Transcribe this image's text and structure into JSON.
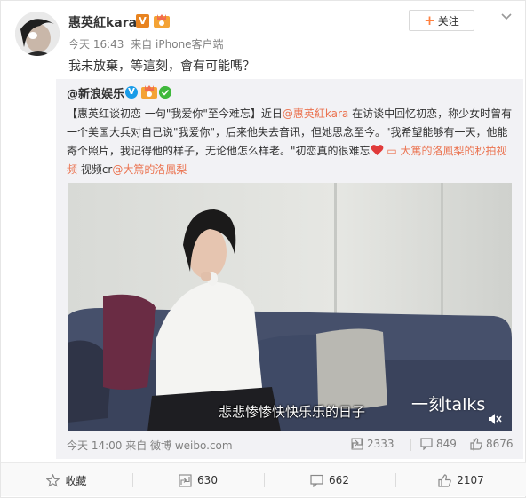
{
  "post": {
    "username": "惠英紅kara",
    "v_badge": "V",
    "time": "今天 16:43",
    "source": "来自 iPhone客户端",
    "text": "我未放棄，等這刻，會有可能嗎？",
    "follow_label": "关注",
    "follow_plus": "+"
  },
  "repost": {
    "username": "@新浪娱乐",
    "text_parts": {
      "line1_a": "【惠英红谈初恋 一句\"我爱你\"至今难忘】近日",
      "mention": "@惠英紅kara",
      "line1_b": " 在访谈中回忆初恋，称少女时曾有一个美国大兵对自己说\"我爱你\"，后来他失去音讯，但她思念至今。\"我希望能够有一天，他能寄个照片，我记得他的样子，无论他怎么样老。\"初恋真的很难忘",
      "video_link": "▭ 大篤的洛鳳梨的秒拍视频",
      "credit_prefix": " 视频cr",
      "credit_mention": "@大篤的洛鳳梨"
    },
    "video": {
      "subtitle": "悲悲惨惨快快乐乐的日子",
      "watermark": "一刻talks"
    },
    "time": "今天 14:00",
    "source": "来自 微博 weibo.com",
    "stats": {
      "reposts": "2333",
      "comments": "849",
      "likes": "8676"
    }
  },
  "actions": {
    "favorite": "收藏",
    "repost": "630",
    "comment": "662",
    "like": "2107"
  },
  "colors": {
    "accent_orange": "#eb7350",
    "verified_blue": "#1a9ce8",
    "v_badge_orange": "#e8831f"
  },
  "icons": [
    "star-icon",
    "repost-icon",
    "comment-icon",
    "like-icon",
    "mute-icon",
    "heart-icon",
    "chevron-down-icon"
  ]
}
